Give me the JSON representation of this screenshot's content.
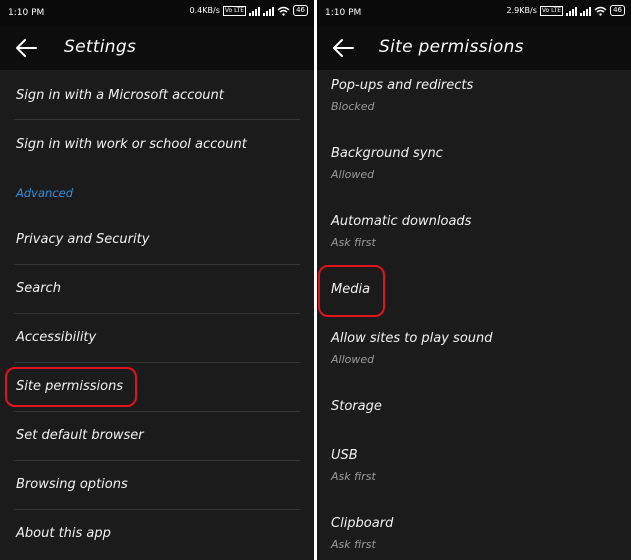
{
  "left": {
    "status": {
      "time": "1:10 PM",
      "speed": "0.4KB/s",
      "volte": "Vo LTE",
      "battery": "46"
    },
    "title": "Settings",
    "items": [
      {
        "label": "Sign in with a Microsoft account"
      },
      {
        "label": "Sign in with work or school account"
      },
      {
        "section": "Advanced"
      },
      {
        "label": "Privacy and Security"
      },
      {
        "label": "Search"
      },
      {
        "label": "Accessibility"
      },
      {
        "label": "Site permissions"
      },
      {
        "label": "Set default browser"
      },
      {
        "label": "Browsing options"
      },
      {
        "label": "About this app"
      }
    ]
  },
  "right": {
    "status": {
      "time": "1:10 PM",
      "speed": "2.9KB/s",
      "volte": "Vo LTE",
      "battery": "46"
    },
    "title": "Site permissions",
    "items": [
      {
        "label": "Pop-ups and redirects",
        "sub": "Blocked"
      },
      {
        "label": "Background sync",
        "sub": "Allowed"
      },
      {
        "label": "Automatic downloads",
        "sub": "Ask first"
      },
      {
        "label": "Media",
        "sub": ""
      },
      {
        "label": "Allow sites to play sound",
        "sub": "Allowed"
      },
      {
        "label": "Storage",
        "sub": ""
      },
      {
        "label": "USB",
        "sub": "Ask first"
      },
      {
        "label": "Clipboard",
        "sub": "Ask first"
      }
    ]
  },
  "colors": {
    "background": "#1b1b1b",
    "appbar": "#0d0d0d",
    "section_accent": "#2f8fe0",
    "highlight": "#e0141c"
  },
  "icons": {
    "back": "arrow-left-icon",
    "wifi": "wifi-icon",
    "signal": "signal-icon",
    "battery": "battery-icon"
  }
}
